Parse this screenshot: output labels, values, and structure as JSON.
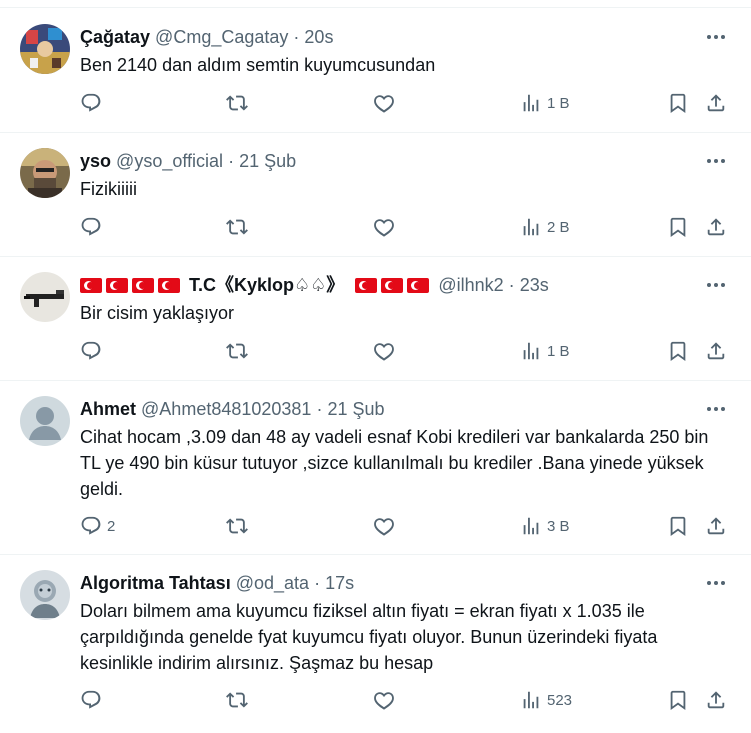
{
  "tweets": [
    {
      "name": "Çağatay",
      "handle": "@Cmg_Cagatay",
      "dot": "·",
      "time": "20s",
      "text": "Ben 2140 dan aldım semtin kuyumcusundan",
      "replies": "",
      "views": "1 B"
    },
    {
      "name": "yso",
      "handle": "@yso_official",
      "dot": "·",
      "time": "21 Şub",
      "text": "Fizikiiiii",
      "replies": "",
      "views": "2 B"
    },
    {
      "name": "T.C《Kyklop♤♤》",
      "handle": "@ilhnk2",
      "dot": "·",
      "time": "23s",
      "text": "Bir cisim yaklaşıyor",
      "replies": "",
      "views": "1 B"
    },
    {
      "name": "Ahmet",
      "handle": "@Ahmet8481020381",
      "dot": "·",
      "time": "21 Şub",
      "text": "Cihat hocam ,3.09 dan 48 ay vadeli esnaf Kobi kredileri var bankalarda 250 bin TL ye 490 bin küsur tutuyor ,sizce kullanılmalı bu krediler .Bana yinede yüksek geldi.",
      "replies": "2",
      "views": "3 B"
    },
    {
      "name": "Algoritma Tahtası",
      "handle": "@od_ata",
      "dot": "·",
      "time": "17s",
      "text": "Doları bilmem ama kuyumcu fiziksel altın fiyatı = ekran fiyatı x 1.035 ile çarpıldığında genelde fyat kuyumcu fiyatı oluyor. Bunun üzerindeki fiyata kesinlikle indirim alırsınız. Şaşmaz bu hesap",
      "replies": "",
      "views": "523"
    }
  ],
  "colors": {
    "text": "#0f1419",
    "secondary": "#536471",
    "border": "#eff3f4",
    "flag": "#e30a17"
  },
  "icons": [
    "more-icon",
    "reply-icon",
    "retweet-icon",
    "like-icon",
    "views-icon",
    "bookmark-icon",
    "share-icon"
  ]
}
